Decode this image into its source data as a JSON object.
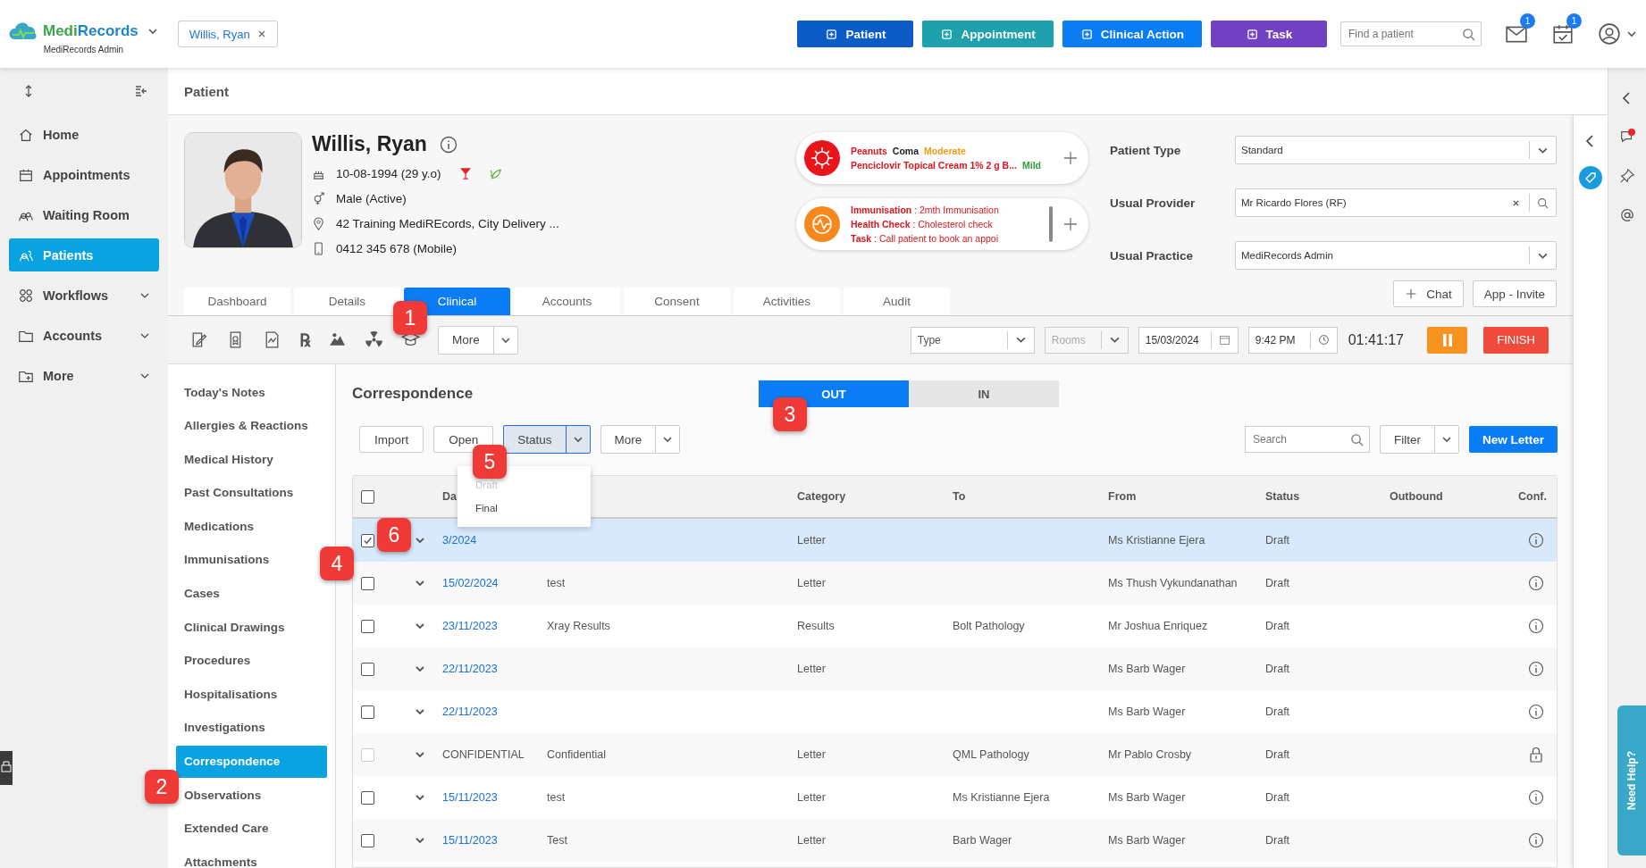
{
  "app": {
    "logo_first": "Medi",
    "logo_second": "Records",
    "org": "MediRecords Admin"
  },
  "open_patient": {
    "label": "Willis, Ryan"
  },
  "header_buttons": [
    {
      "label": "Patient",
      "color": "#0b5cc7"
    },
    {
      "label": "Appointment",
      "color": "#1ea1ad"
    },
    {
      "label": "Clinical Action",
      "color": "#0a7cf5"
    },
    {
      "label": "Task",
      "color": "#7242c4"
    }
  ],
  "patient_search": {
    "placeholder": "Find a patient"
  },
  "notifications": [
    {
      "count": "1"
    },
    {
      "count": "1"
    }
  ],
  "nav": [
    {
      "label": "Home",
      "selected": false,
      "expandable": false
    },
    {
      "label": "Appointments",
      "selected": false,
      "expandable": false
    },
    {
      "label": "Waiting Room",
      "selected": false,
      "expandable": false
    },
    {
      "label": "Patients",
      "selected": true,
      "expandable": false
    },
    {
      "label": "Workflows",
      "selected": false,
      "expandable": true
    },
    {
      "label": "Accounts",
      "selected": false,
      "expandable": true
    },
    {
      "label": "More",
      "selected": false,
      "expandable": true
    }
  ],
  "page_title": "Patient",
  "patient": {
    "name": "Willis, Ryan",
    "dob": "10-08-1994 (29 y.o)",
    "gender": "Male (Active)",
    "address": "42 Training MediREcords, City Delivery ...",
    "phone": "0412 345 678 (Mobile)"
  },
  "allergies": [
    {
      "substance": "Peanuts",
      "reaction": "Coma",
      "severity": "Moderate",
      "color": "#f39c12"
    },
    {
      "substance": "Penciclovir Topical Cream 1% 2 g B...",
      "severity": "Mild",
      "color": "#2e9d3a"
    }
  ],
  "reminders": [
    "**Immunisation** : 2mth Immunisation",
    "**Health Check** : Cholesterol check",
    "**Task** : Call patient to book an appoi"
  ],
  "fields": [
    {
      "label": "Patient Type",
      "value": "Standard",
      "kind": "select"
    },
    {
      "label": "Usual Provider",
      "value": "Mr Ricardo Flores (RF)",
      "kind": "search"
    },
    {
      "label": "Usual Practice",
      "value": "MediRecords Admin",
      "kind": "select"
    }
  ],
  "side_buttons": [
    {
      "label": "Chat",
      "kind": "add"
    },
    {
      "label": "App - Invite",
      "kind": "plain"
    }
  ],
  "tabs": [
    {
      "label": "Dashboard",
      "selected": false
    },
    {
      "label": "Details",
      "selected": false
    },
    {
      "label": "Clinical",
      "selected": true
    },
    {
      "label": "Accounts",
      "selected": false
    },
    {
      "label": "Consent",
      "selected": false
    },
    {
      "label": "Activities",
      "selected": false
    },
    {
      "label": "Audit",
      "selected": false
    }
  ],
  "toolbar": {
    "rx": "℞",
    "more": "More",
    "type_placeholder": "Type",
    "rooms_placeholder": "Rooms",
    "date": "15/03/2024",
    "time": "9:42 PM",
    "timer": "01:41:17",
    "finish": "FINISH"
  },
  "clinical_nav": [
    {
      "label": "Today's Notes",
      "selected": false
    },
    {
      "label": "Allergies & Reactions",
      "selected": false
    },
    {
      "label": "Medical History",
      "selected": false
    },
    {
      "label": "Past Consultations",
      "selected": false
    },
    {
      "label": "Medications",
      "selected": false
    },
    {
      "label": "Immunisations",
      "selected": false
    },
    {
      "label": "Cases",
      "selected": false
    },
    {
      "label": "Clinical Drawings",
      "selected": false
    },
    {
      "label": "Procedures",
      "selected": false
    },
    {
      "label": "Hospitalisations",
      "selected": false
    },
    {
      "label": "Investigations",
      "selected": false
    },
    {
      "label": "Correspondence",
      "selected": true
    },
    {
      "label": "Observations",
      "selected": false
    },
    {
      "label": "Extended Care",
      "selected": false
    },
    {
      "label": "Attachments",
      "selected": false
    }
  ],
  "section_title": "Correspondence",
  "direction": [
    {
      "label": "OUT",
      "selected": true
    },
    {
      "label": "IN",
      "selected": false
    }
  ],
  "list_buttons": [
    {
      "label": "Import",
      "kind": "plain",
      "active": false
    },
    {
      "label": "Open",
      "kind": "plain",
      "active": false
    },
    {
      "label": "Status",
      "kind": "split",
      "active": true
    },
    {
      "label": "More",
      "kind": "split",
      "active": false
    }
  ],
  "letter_search": {
    "placeholder": "Search"
  },
  "filter": {
    "label": "Filter"
  },
  "new_letter": {
    "label": "New Letter"
  },
  "status_menu": [
    {
      "label": "Draft",
      "disabled": true
    },
    {
      "label": "Final",
      "disabled": false
    }
  ],
  "table": {
    "select_all": {
      "checked": false
    },
    "columns": [
      "Da",
      "Category",
      "To",
      "From",
      "Status",
      "Outbound",
      "Conf."
    ],
    "rows": [
      {
        "selected": true,
        "checked": true,
        "disabled": false,
        "confidential": false,
        "date": "3/2024",
        "subject": "",
        "category": "Letter",
        "to": "",
        "from": "Ms Kristianne Ejera",
        "status": "Draft"
      },
      {
        "selected": false,
        "checked": false,
        "disabled": false,
        "confidential": false,
        "date": "15/02/2024",
        "subject": "test",
        "category": "Letter",
        "to": "",
        "from": "Ms Thush Vykundanathan",
        "status": "Draft"
      },
      {
        "selected": false,
        "checked": false,
        "disabled": false,
        "confidential": false,
        "date": "23/11/2023",
        "subject": "Xray Results",
        "category": "Results",
        "to": "Bolt Pathology",
        "from": "Mr Joshua Enriquez",
        "status": "Draft"
      },
      {
        "selected": false,
        "checked": false,
        "disabled": false,
        "confidential": false,
        "date": "22/11/2023",
        "subject": "",
        "category": "Letter",
        "to": "",
        "from": "Ms Barb Wager",
        "status": "Draft"
      },
      {
        "selected": false,
        "checked": false,
        "disabled": false,
        "confidential": false,
        "date": "22/11/2023",
        "subject": "",
        "category": "",
        "to": "",
        "from": "Ms Barb Wager",
        "status": "Draft"
      },
      {
        "selected": false,
        "checked": false,
        "disabled": true,
        "confidential": true,
        "date": "CONFIDENTIAL",
        "subject": "Confidential",
        "category": "Letter",
        "to": "QML Pathology",
        "from": "Mr Pablo Crosby",
        "status": "Draft"
      },
      {
        "selected": false,
        "checked": false,
        "disabled": false,
        "confidential": false,
        "date": "15/11/2023",
        "subject": "test",
        "category": "Letter",
        "to": "Ms Kristianne Ejera",
        "from": "Ms Barb Wager",
        "status": "Draft"
      },
      {
        "selected": false,
        "checked": false,
        "disabled": false,
        "confidential": false,
        "date": "15/11/2023",
        "subject": "Test",
        "category": "Letter",
        "to": "Barb Wager",
        "from": "Ms Barb Wager",
        "status": "Draft"
      }
    ]
  },
  "help_tab": {
    "label": "Need Help?"
  },
  "markers": [
    {
      "label": "1"
    },
    {
      "label": "2"
    },
    {
      "label": "3"
    },
    {
      "label": "4"
    },
    {
      "label": "5"
    },
    {
      "label": "6"
    }
  ]
}
